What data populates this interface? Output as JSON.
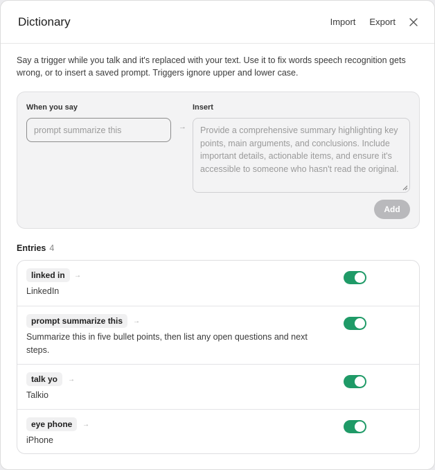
{
  "header": {
    "title": "Dictionary",
    "import_label": "Import",
    "export_label": "Export",
    "close_icon": "close-icon"
  },
  "description": "Say a trigger while you talk and it's replaced with your text. Use it to fix words speech recognition gets wrong, or to insert a saved prompt. Triggers ignore upper and lower case.",
  "form": {
    "when_label": "When you say",
    "insert_label": "Insert",
    "trigger_placeholder": "prompt summarize this",
    "arrow": "→",
    "insert_placeholder": "Provide a comprehensive summary highlighting key points, main arguments, and conclusions. Include important details, actionable items, and ensure it's accessible to someone who hasn't read the original.",
    "add_label": "Add"
  },
  "entries": {
    "heading": "Entries",
    "count": "4",
    "items": [
      {
        "trigger": "linked in",
        "arrow": "→",
        "replacement": "LinkedIn",
        "enabled": true
      },
      {
        "trigger": "prompt summarize this",
        "arrow": "→",
        "replacement": "Summarize this in five bullet points, then list any open questions and next steps.",
        "enabled": true
      },
      {
        "trigger": "talk yo",
        "arrow": "→",
        "replacement": "Talkio",
        "enabled": true
      },
      {
        "trigger": "eye phone",
        "arrow": "→",
        "replacement": "iPhone",
        "enabled": true
      }
    ]
  },
  "colors": {
    "toggle_on": "#1f9a67",
    "add_disabled": "#b9b9bc"
  }
}
